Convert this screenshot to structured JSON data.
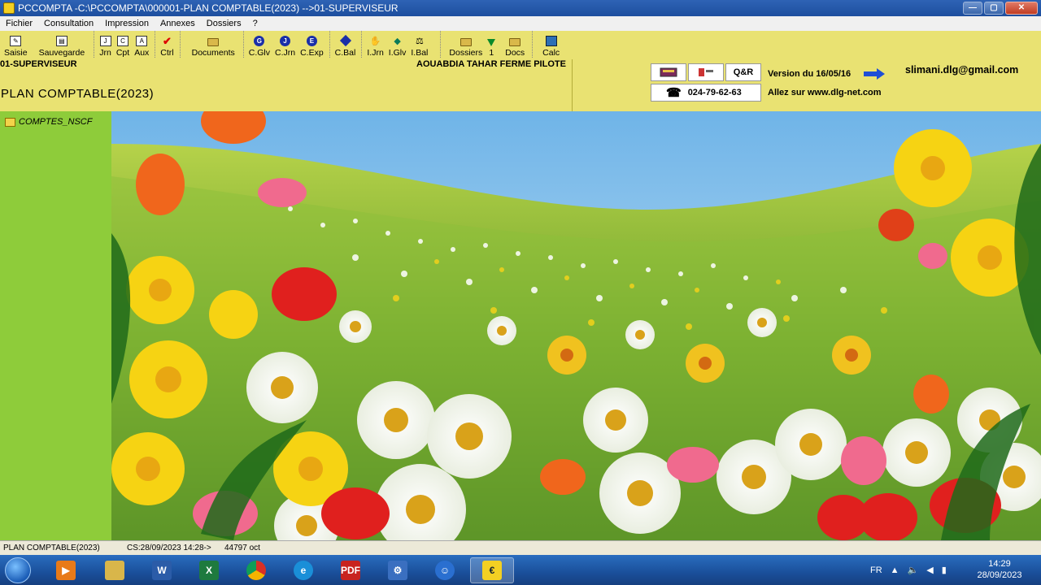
{
  "window": {
    "title": "PCCOMPTA -C:\\PCCOMPTA\\000001-PLAN COMPTABLE(2023) -->01-SUPERVISEUR",
    "min": "—",
    "max": "▢",
    "close": "✕"
  },
  "menu": [
    "Fichier",
    "Consultation",
    "Impression",
    "Annexes",
    "Dossiers",
    "?"
  ],
  "toolbar": [
    {
      "label": "Saisie",
      "icon": "pencil-icon"
    },
    {
      "label": "Sauvegarde",
      "icon": "save-icon"
    },
    {
      "label": "Jrn",
      "icon": "journal-icon"
    },
    {
      "label": "Cpt",
      "icon": "account-icon"
    },
    {
      "label": "Aux",
      "icon": "auxiliary-icon"
    },
    {
      "label": "Ctrl",
      "icon": "check-icon"
    },
    {
      "label": "Documents",
      "icon": "folder-icon"
    },
    {
      "label": "C.Glv",
      "icon": "circle-g-icon",
      "glyph": "G"
    },
    {
      "label": "C.Jrn",
      "icon": "circle-j-icon",
      "glyph": "J"
    },
    {
      "label": "C.Exp",
      "icon": "circle-e-icon",
      "glyph": "E"
    },
    {
      "label": "C.Bal",
      "icon": "diamond-icon"
    },
    {
      "label": "I.Jrn",
      "icon": "hand-icon"
    },
    {
      "label": "I.Glv",
      "icon": "book-icon"
    },
    {
      "label": "I.Bal",
      "icon": "scale-icon"
    },
    {
      "label": "Dossiers",
      "icon": "folder-open-icon"
    },
    {
      "label": "1",
      "icon": "triangle-down-icon"
    },
    {
      "label": "Docs",
      "icon": "docs-folder-icon"
    },
    {
      "label": "Calc",
      "icon": "calculator-icon"
    }
  ],
  "header": {
    "user": "01-SUPERVISEUR",
    "plan": "PLAN COMPTABLE(2023)",
    "company": "AOUABDIA TAHAR FERME PILOTE",
    "qr": "Q&R",
    "phone": "024-79-62-63",
    "version": "Version du 16/05/16",
    "email": "slimani.dlg@gmail.com",
    "allez": "Allez sur  www.dlg-net.com"
  },
  "sidebar": {
    "item": "COMPTES_NSCF"
  },
  "status": {
    "file": "PLAN COMPTABLE(2023)",
    "cs": "CS:28/09/2023 14:28->",
    "size": "44797 oct"
  },
  "taskbar": {
    "lang": "FR",
    "time": "14:29",
    "date": "28/09/2023"
  },
  "colors": {
    "toolbar_bg": "#e9e272",
    "sidebar_bg": "#8ecc3a",
    "title_bg": "#2e63b5"
  }
}
